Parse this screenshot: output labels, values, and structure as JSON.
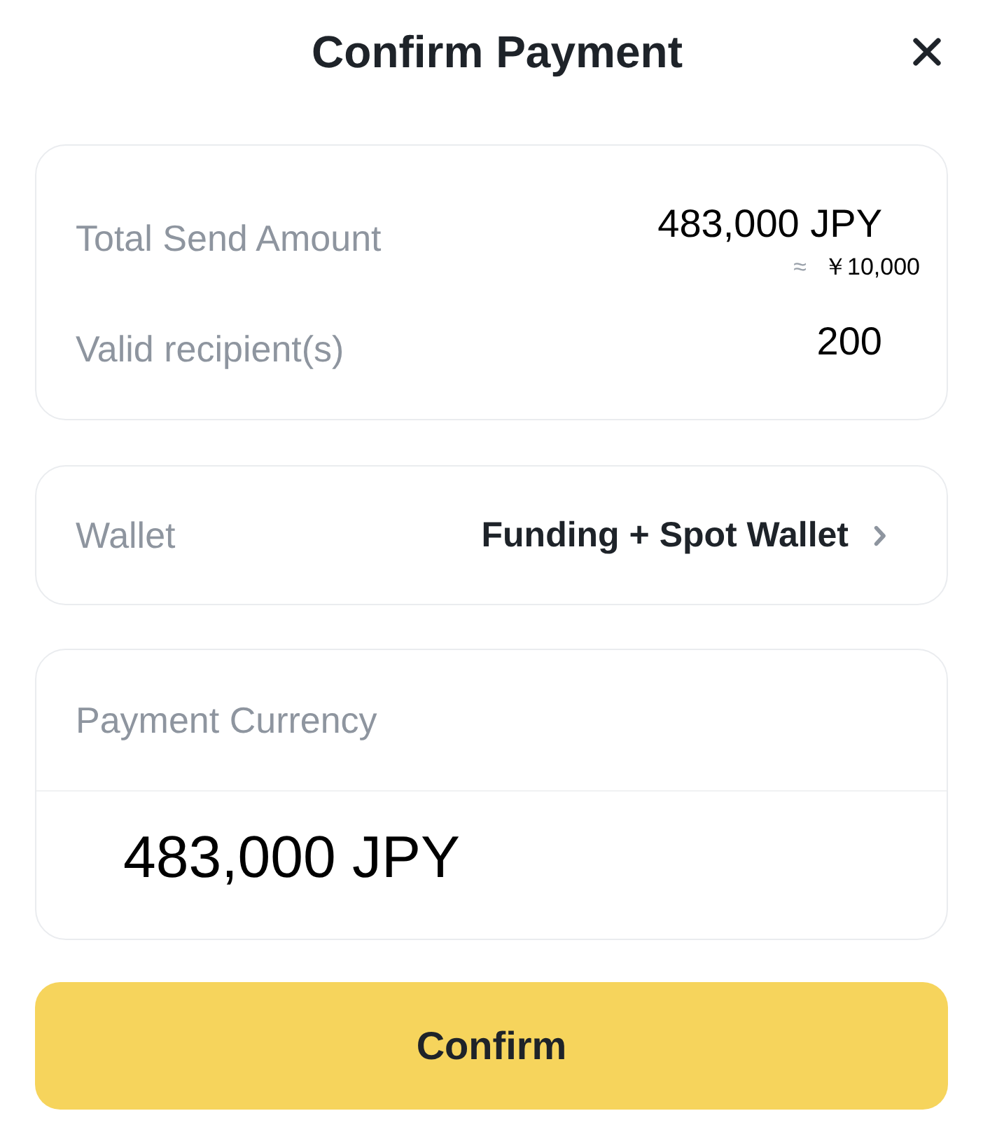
{
  "header": {
    "title": "Confirm Payment"
  },
  "summary": {
    "rows": [
      {
        "kind": "amount",
        "label": "Total Send Amount",
        "value": "483,000 JPY",
        "approx_sign": "≈",
        "estimate": "￥10,000"
      },
      {
        "kind": "plain",
        "label": "Valid recipient(s)",
        "value": "200"
      }
    ]
  },
  "wallet": {
    "label": "Wallet",
    "value": "Funding + Spot Wallet"
  },
  "payment_currency": {
    "label": "Payment Currency",
    "amount": "483,000 JPY"
  },
  "confirm_button": {
    "label": "Confirm"
  }
}
